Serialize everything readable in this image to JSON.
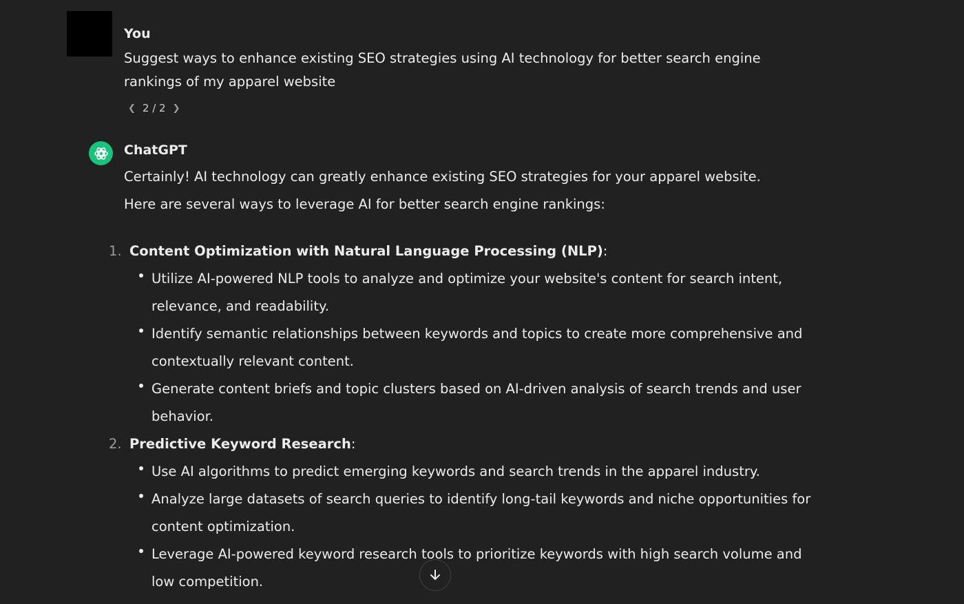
{
  "user_message": {
    "author": "You",
    "text": "Suggest ways to enhance existing SEO strategies using AI technology for better search engine rankings of my apparel website",
    "pager": {
      "prev_icon": "chevron-left-icon",
      "label": "2 / 2",
      "next_icon": "chevron-right-icon"
    }
  },
  "assistant_message": {
    "author": "ChatGPT",
    "intro_1": "Certainly! AI technology can greatly enhance existing SEO strategies for your apparel website.",
    "intro_2": "Here are several ways to leverage AI for better search engine rankings:",
    "sections": [
      {
        "number": "1.",
        "title": "Content Optimization with Natural Language Processing (NLP)",
        "colon": ":",
        "bullets": [
          "Utilize AI-powered NLP tools to analyze and optimize your website's content for search intent, relevance, and readability.",
          "Identify semantic relationships between keywords and topics to create more comprehensive and contextually relevant content.",
          "Generate content briefs and topic clusters based on AI-driven analysis of search trends and user behavior."
        ]
      },
      {
        "number": "2.",
        "title": "Predictive Keyword Research",
        "colon": ":",
        "bullets": [
          "Use AI algorithms to predict emerging keywords and search trends in the apparel industry.",
          "Analyze large datasets of search queries to identify long-tail keywords and niche opportunities for content optimization.",
          "Leverage AI-powered keyword research tools to prioritize keywords with high search volume and low competition."
        ]
      }
    ]
  },
  "scroll_button": {
    "icon": "arrow-down-icon"
  },
  "colors": {
    "background": "#212121",
    "text": "#ececec",
    "accent": "#19c37d",
    "user_avatar": "#000000"
  }
}
